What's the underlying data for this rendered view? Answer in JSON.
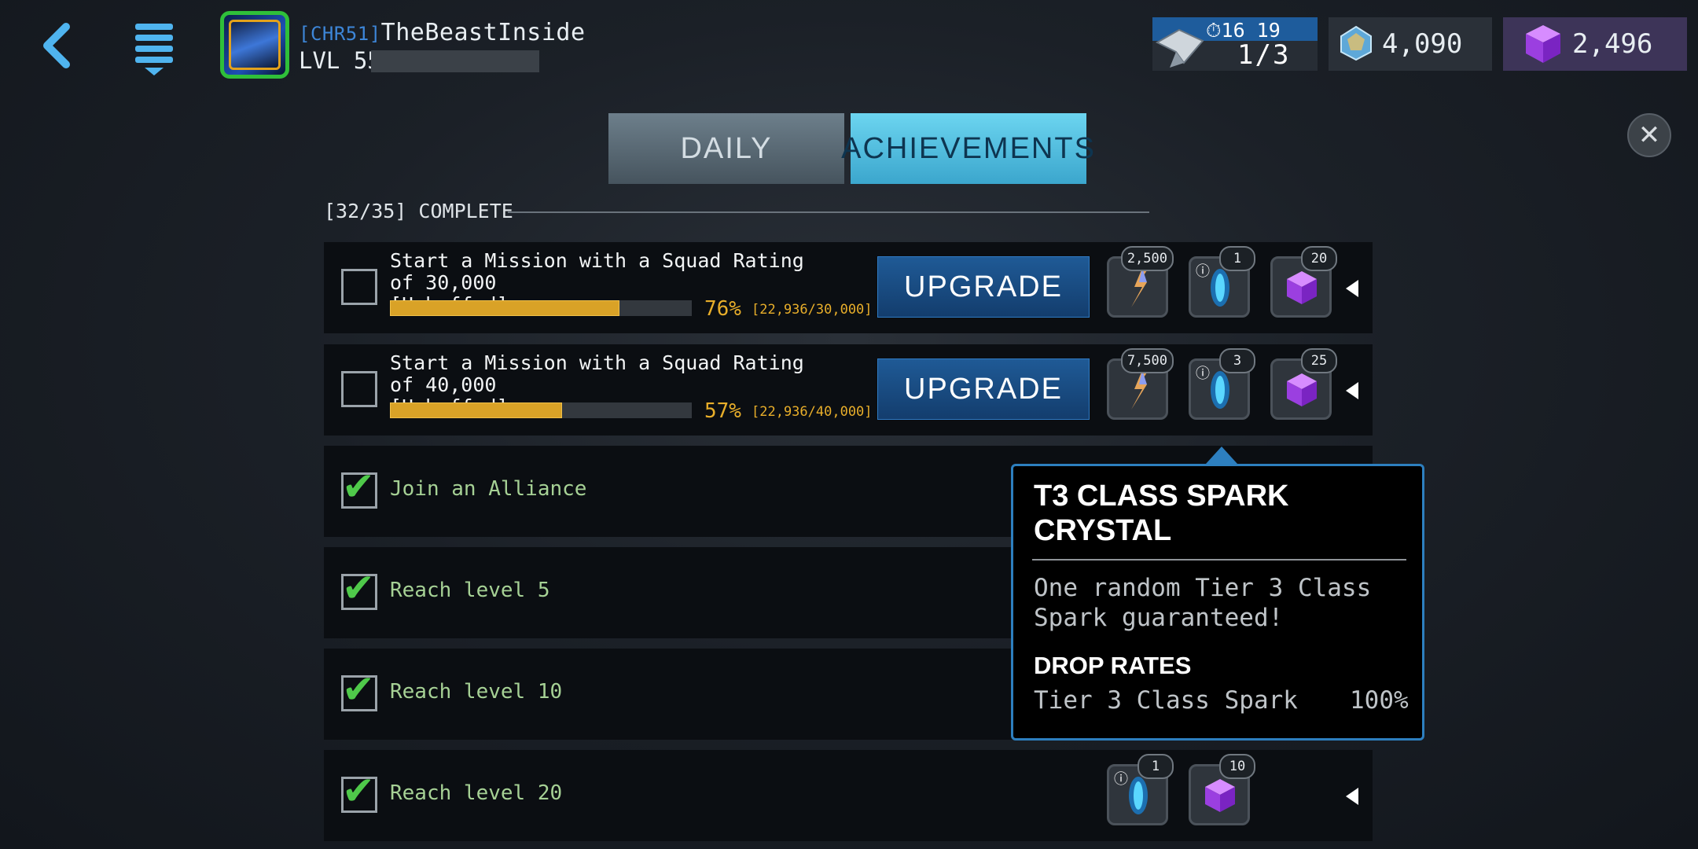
{
  "header": {
    "player_tag": "[CHR51]",
    "player_name": "TheBeastInside",
    "level_text": "LVL 55",
    "energy_timer": "16 19",
    "energy_count": "1/3",
    "crystals": "4,090",
    "gems": "2,496",
    "back_icon": "chevron-left-icon",
    "menu_icon": "menu-icon",
    "close_icon": "close-icon"
  },
  "tabs": [
    {
      "label": "DAILY",
      "active": false
    },
    {
      "label": "ACHIEVEMENTS",
      "active": true
    }
  ],
  "progress_summary": "[32/35] COMPLETE",
  "achievements": [
    {
      "title": "Start a Mission with a Squad Rating of 30,000\n[Unbuffed]",
      "progress_fraction": 0.76,
      "percent": "76%",
      "count": "[22,936/30,000]",
      "button": "UPGRADE",
      "rewards": [
        "2,500",
        "1",
        "20"
      ]
    },
    {
      "title": "Start a Mission with a Squad Rating of 40,000\n[Unbuffed]",
      "progress_fraction": 0.57,
      "percent": "57%",
      "count": "[22,936/40,000]",
      "button": "UPGRADE",
      "rewards": [
        "7,500",
        "3",
        "25"
      ]
    },
    {
      "title": "Join an Alliance",
      "done": true
    },
    {
      "title": "Reach level 5",
      "done": true
    },
    {
      "title": "Reach level 10",
      "done": true
    },
    {
      "title": "Reach level 20",
      "done": true,
      "rewards": [
        "1",
        "10"
      ]
    }
  ],
  "tooltip": {
    "title": "T3 CLASS SPARK CRYSTAL",
    "description": "One random Tier 3 Class Spark guaranteed!",
    "drop_rates_label": "DROP RATES",
    "drop_item": "Tier 3 Class Spark",
    "drop_rate": "100%"
  },
  "colors": {
    "accent_blue": "#3ba6cd",
    "progress_gold": "#d9a227",
    "check_green": "#4fc94a",
    "tooltip_border": "#2d7fbf"
  }
}
